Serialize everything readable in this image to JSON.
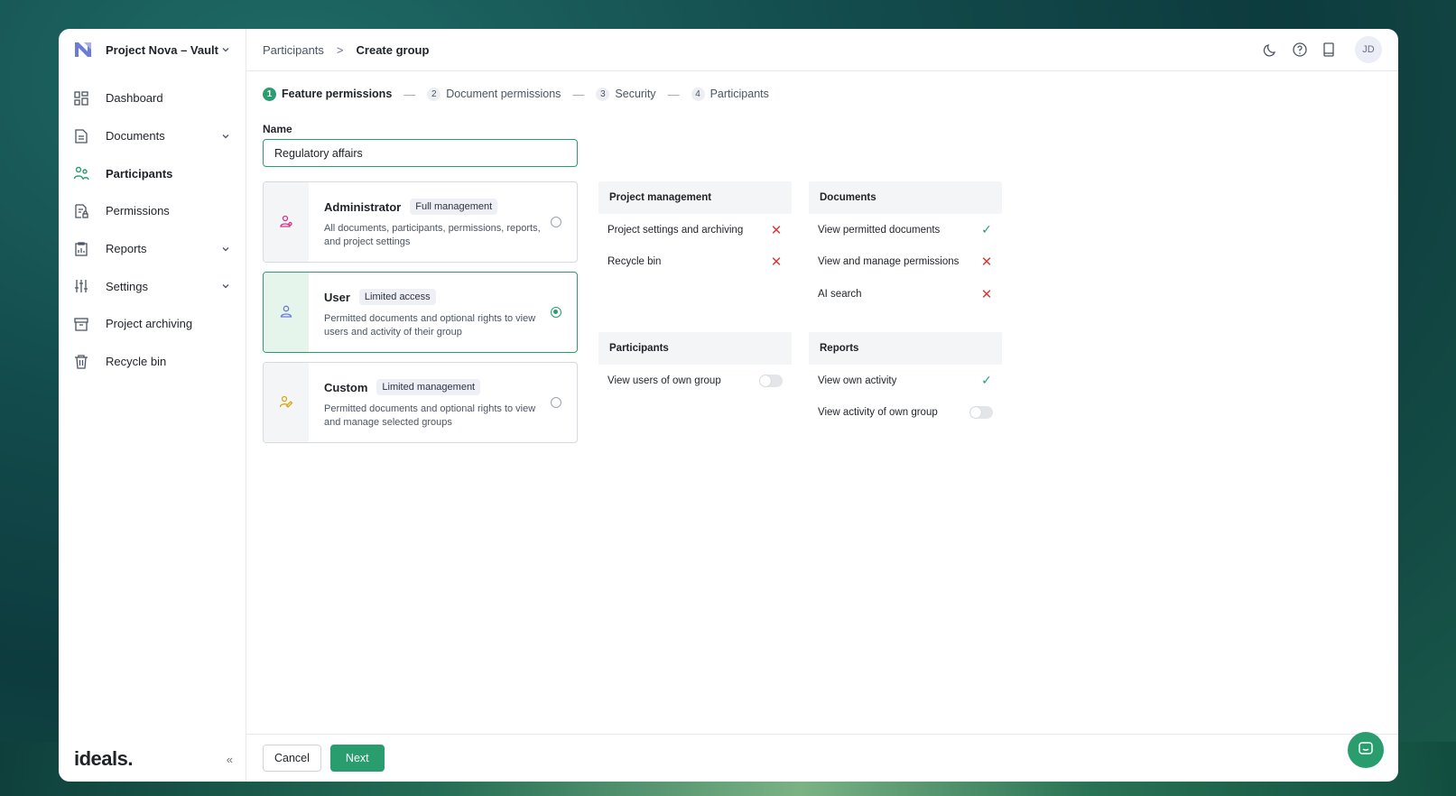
{
  "project": {
    "name": "Project Nova – Vault"
  },
  "sidebar": {
    "items": [
      {
        "label": "Dashboard",
        "icon": "dashboard-icon"
      },
      {
        "label": "Documents",
        "icon": "documents-icon",
        "expandable": true
      },
      {
        "label": "Participants",
        "icon": "participants-icon",
        "active": true
      },
      {
        "label": "Permissions",
        "icon": "permissions-icon"
      },
      {
        "label": "Reports",
        "icon": "reports-icon",
        "expandable": true
      },
      {
        "label": "Settings",
        "icon": "settings-icon",
        "expandable": true
      },
      {
        "label": "Project archiving",
        "icon": "archive-icon"
      },
      {
        "label": "Recycle bin",
        "icon": "trash-icon"
      }
    ],
    "brand": "ideals.",
    "collapse_label": "«"
  },
  "breadcrumb": {
    "parent": "Participants",
    "separator": ">",
    "current": "Create group"
  },
  "user": {
    "initials": "JD"
  },
  "steps": [
    {
      "num": "1",
      "label": "Feature permissions",
      "active": true
    },
    {
      "num": "2",
      "label": "Document permissions"
    },
    {
      "num": "3",
      "label": "Security"
    },
    {
      "num": "4",
      "label": "Participants"
    }
  ],
  "step_separator": "—",
  "form": {
    "name_label": "Name",
    "name_value": "Regulatory affairs"
  },
  "roles": [
    {
      "title": "Administrator",
      "badge": "Full management",
      "desc": "All documents, participants, permissions, reports, and project settings",
      "selected": false
    },
    {
      "title": "User",
      "badge": "Limited access",
      "desc": "Permitted documents and optional rights to view users and activity of their group",
      "selected": true
    },
    {
      "title": "Custom",
      "badge": "Limited management",
      "desc": "Permitted documents and optional rights to view and manage selected groups",
      "selected": false
    }
  ],
  "permissions": {
    "project_management": {
      "title": "Project management",
      "rows": [
        {
          "label": "Project settings and archiving",
          "state": "denied"
        },
        {
          "label": "Recycle bin",
          "state": "denied"
        }
      ]
    },
    "documents": {
      "title": "Documents",
      "rows": [
        {
          "label": "View permitted documents",
          "state": "allowed"
        },
        {
          "label": "View and manage permissions",
          "state": "denied"
        },
        {
          "label": "AI search",
          "state": "denied"
        }
      ]
    },
    "participants": {
      "title": "Participants",
      "rows": [
        {
          "label": "View users of own group",
          "state": "toggle-off"
        }
      ]
    },
    "reports": {
      "title": "Reports",
      "rows": [
        {
          "label": "View own activity",
          "state": "allowed"
        },
        {
          "label": "View activity of own group",
          "state": "toggle-off"
        }
      ]
    }
  },
  "footer": {
    "cancel_label": "Cancel",
    "next_label": "Next"
  },
  "colors": {
    "accent": "#2a9d6f",
    "danger": "#d83a3a",
    "admin_icon": "#d63384",
    "user_icon": "#6b7bd8",
    "custom_icon": "#d9a514"
  }
}
